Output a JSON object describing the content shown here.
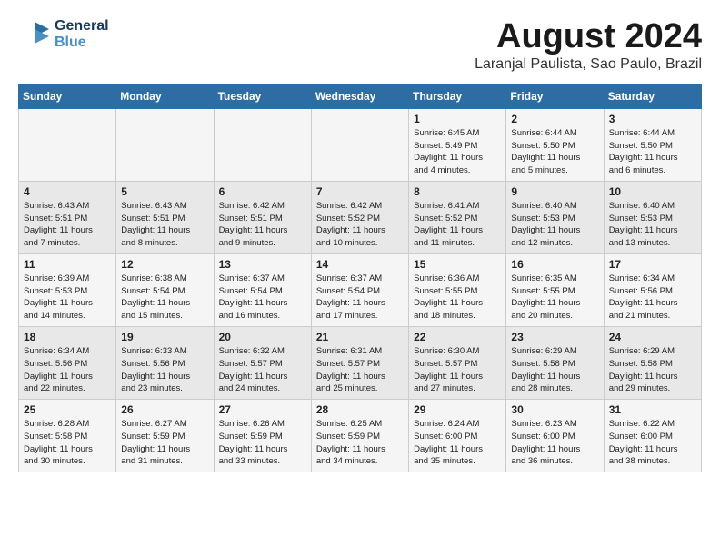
{
  "header": {
    "logo_line1": "General",
    "logo_line2": "Blue",
    "main_title": "August 2024",
    "subtitle": "Laranjal Paulista, Sao Paulo, Brazil"
  },
  "weekdays": [
    "Sunday",
    "Monday",
    "Tuesday",
    "Wednesday",
    "Thursday",
    "Friday",
    "Saturday"
  ],
  "weeks": [
    [
      {
        "day": "",
        "info": ""
      },
      {
        "day": "",
        "info": ""
      },
      {
        "day": "",
        "info": ""
      },
      {
        "day": "",
        "info": ""
      },
      {
        "day": "1",
        "info": "Sunrise: 6:45 AM\nSunset: 5:49 PM\nDaylight: 11 hours\nand 4 minutes."
      },
      {
        "day": "2",
        "info": "Sunrise: 6:44 AM\nSunset: 5:50 PM\nDaylight: 11 hours\nand 5 minutes."
      },
      {
        "day": "3",
        "info": "Sunrise: 6:44 AM\nSunset: 5:50 PM\nDaylight: 11 hours\nand 6 minutes."
      }
    ],
    [
      {
        "day": "4",
        "info": "Sunrise: 6:43 AM\nSunset: 5:51 PM\nDaylight: 11 hours\nand 7 minutes."
      },
      {
        "day": "5",
        "info": "Sunrise: 6:43 AM\nSunset: 5:51 PM\nDaylight: 11 hours\nand 8 minutes."
      },
      {
        "day": "6",
        "info": "Sunrise: 6:42 AM\nSunset: 5:51 PM\nDaylight: 11 hours\nand 9 minutes."
      },
      {
        "day": "7",
        "info": "Sunrise: 6:42 AM\nSunset: 5:52 PM\nDaylight: 11 hours\nand 10 minutes."
      },
      {
        "day": "8",
        "info": "Sunrise: 6:41 AM\nSunset: 5:52 PM\nDaylight: 11 hours\nand 11 minutes."
      },
      {
        "day": "9",
        "info": "Sunrise: 6:40 AM\nSunset: 5:53 PM\nDaylight: 11 hours\nand 12 minutes."
      },
      {
        "day": "10",
        "info": "Sunrise: 6:40 AM\nSunset: 5:53 PM\nDaylight: 11 hours\nand 13 minutes."
      }
    ],
    [
      {
        "day": "11",
        "info": "Sunrise: 6:39 AM\nSunset: 5:53 PM\nDaylight: 11 hours\nand 14 minutes."
      },
      {
        "day": "12",
        "info": "Sunrise: 6:38 AM\nSunset: 5:54 PM\nDaylight: 11 hours\nand 15 minutes."
      },
      {
        "day": "13",
        "info": "Sunrise: 6:37 AM\nSunset: 5:54 PM\nDaylight: 11 hours\nand 16 minutes."
      },
      {
        "day": "14",
        "info": "Sunrise: 6:37 AM\nSunset: 5:54 PM\nDaylight: 11 hours\nand 17 minutes."
      },
      {
        "day": "15",
        "info": "Sunrise: 6:36 AM\nSunset: 5:55 PM\nDaylight: 11 hours\nand 18 minutes."
      },
      {
        "day": "16",
        "info": "Sunrise: 6:35 AM\nSunset: 5:55 PM\nDaylight: 11 hours\nand 20 minutes."
      },
      {
        "day": "17",
        "info": "Sunrise: 6:34 AM\nSunset: 5:56 PM\nDaylight: 11 hours\nand 21 minutes."
      }
    ],
    [
      {
        "day": "18",
        "info": "Sunrise: 6:34 AM\nSunset: 5:56 PM\nDaylight: 11 hours\nand 22 minutes."
      },
      {
        "day": "19",
        "info": "Sunrise: 6:33 AM\nSunset: 5:56 PM\nDaylight: 11 hours\nand 23 minutes."
      },
      {
        "day": "20",
        "info": "Sunrise: 6:32 AM\nSunset: 5:57 PM\nDaylight: 11 hours\nand 24 minutes."
      },
      {
        "day": "21",
        "info": "Sunrise: 6:31 AM\nSunset: 5:57 PM\nDaylight: 11 hours\nand 25 minutes."
      },
      {
        "day": "22",
        "info": "Sunrise: 6:30 AM\nSunset: 5:57 PM\nDaylight: 11 hours\nand 27 minutes."
      },
      {
        "day": "23",
        "info": "Sunrise: 6:29 AM\nSunset: 5:58 PM\nDaylight: 11 hours\nand 28 minutes."
      },
      {
        "day": "24",
        "info": "Sunrise: 6:29 AM\nSunset: 5:58 PM\nDaylight: 11 hours\nand 29 minutes."
      }
    ],
    [
      {
        "day": "25",
        "info": "Sunrise: 6:28 AM\nSunset: 5:58 PM\nDaylight: 11 hours\nand 30 minutes."
      },
      {
        "day": "26",
        "info": "Sunrise: 6:27 AM\nSunset: 5:59 PM\nDaylight: 11 hours\nand 31 minutes."
      },
      {
        "day": "27",
        "info": "Sunrise: 6:26 AM\nSunset: 5:59 PM\nDaylight: 11 hours\nand 33 minutes."
      },
      {
        "day": "28",
        "info": "Sunrise: 6:25 AM\nSunset: 5:59 PM\nDaylight: 11 hours\nand 34 minutes."
      },
      {
        "day": "29",
        "info": "Sunrise: 6:24 AM\nSunset: 6:00 PM\nDaylight: 11 hours\nand 35 minutes."
      },
      {
        "day": "30",
        "info": "Sunrise: 6:23 AM\nSunset: 6:00 PM\nDaylight: 11 hours\nand 36 minutes."
      },
      {
        "day": "31",
        "info": "Sunrise: 6:22 AM\nSunset: 6:00 PM\nDaylight: 11 hours\nand 38 minutes."
      }
    ]
  ]
}
